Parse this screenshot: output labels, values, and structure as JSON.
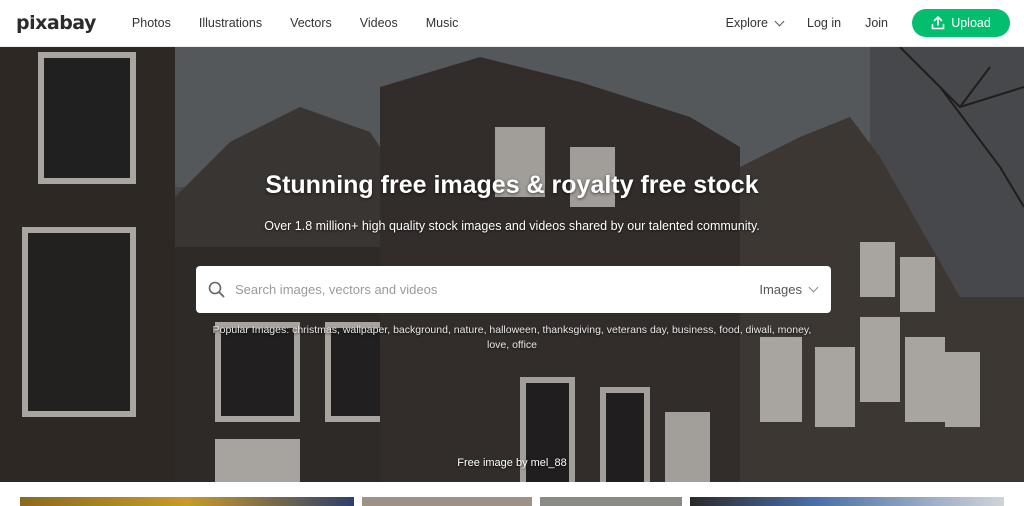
{
  "header": {
    "logo": "pixabay",
    "nav": [
      "Photos",
      "Illustrations",
      "Vectors",
      "Videos",
      "Music"
    ],
    "explore_label": "Explore",
    "login_label": "Log in",
    "join_label": "Join",
    "upload_label": "Upload"
  },
  "hero": {
    "title": "Stunning free images & royalty free stock",
    "subtitle": "Over 1.8 million+ high quality stock images and videos shared by our talented community.",
    "search": {
      "placeholder": "Search images, vectors and videos",
      "value": "",
      "type_selected": "Images"
    },
    "popular": {
      "label": "Popular Images:",
      "tags": [
        "christmas",
        "wallpaper",
        "background",
        "nature",
        "halloween",
        "thanksgiving",
        "veterans day",
        "business",
        "food",
        "diwali",
        "money",
        "love",
        "office"
      ]
    },
    "credit": "Free image by mel_88"
  },
  "colors": {
    "accent": "#02be6e",
    "header_bg": "#ffffff",
    "text": "#333333"
  },
  "icons": {
    "search": "search-icon",
    "upload": "upload-icon",
    "explore_chevron": "chevron-down-icon",
    "type_chevron": "chevron-down-icon"
  }
}
